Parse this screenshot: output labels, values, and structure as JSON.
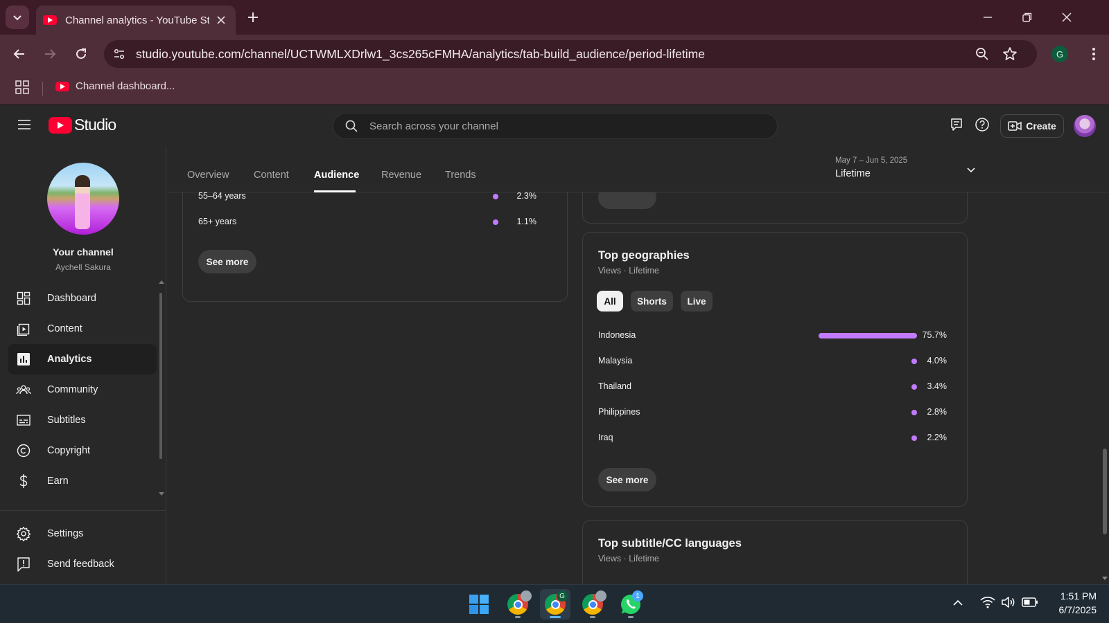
{
  "browser": {
    "tab_title": "Channel analytics - YouTube Studio",
    "url": "studio.youtube.com/channel/UCTWMLXDrlw1_3cs265cFMHA/analytics/tab-build_audience/period-lifetime",
    "bookmark_label": "Channel dashboard...",
    "profile_initial": "G"
  },
  "header": {
    "logo_text": "Studio",
    "search_placeholder": "Search across your channel",
    "create_label": "Create"
  },
  "sidebar": {
    "your_channel": "Your channel",
    "channel_name": "Aychell Sakura",
    "items": [
      {
        "label": "Dashboard",
        "icon": "dashboard-icon"
      },
      {
        "label": "Content",
        "icon": "content-icon"
      },
      {
        "label": "Analytics",
        "icon": "analytics-icon",
        "active": true
      },
      {
        "label": "Community",
        "icon": "community-icon"
      },
      {
        "label": "Subtitles",
        "icon": "subtitles-icon"
      },
      {
        "label": "Copyright",
        "icon": "copyright-icon"
      },
      {
        "label": "Earn",
        "icon": "earn-icon"
      }
    ],
    "bottom_items": [
      {
        "label": "Settings",
        "icon": "gear-icon"
      },
      {
        "label": "Send feedback",
        "icon": "feedback-icon"
      }
    ]
  },
  "tabs": {
    "overview": "Overview",
    "content": "Content",
    "audience": "Audience",
    "revenue": "Revenue",
    "trends": "Trends",
    "active": "Audience"
  },
  "period": {
    "range": "May 7 – Jun 5, 2025",
    "value": "Lifetime"
  },
  "age_card": {
    "rows": [
      {
        "label": "55–64 years",
        "value": "2.3%"
      },
      {
        "label": "65+ years",
        "value": "1.1%"
      }
    ],
    "see_more": "See more"
  },
  "geo_card": {
    "title": "Top geographies",
    "subtitle": "Views · Lifetime",
    "chips": [
      "All",
      "Shorts",
      "Live"
    ],
    "selected_chip": "All",
    "rows": [
      {
        "label": "Indonesia",
        "value": "75.7%",
        "fraction": 0.757
      },
      {
        "label": "Malaysia",
        "value": "4.0%",
        "fraction": 0.04
      },
      {
        "label": "Thailand",
        "value": "3.4%",
        "fraction": 0.034
      },
      {
        "label": "Philippines",
        "value": "2.8%",
        "fraction": 0.028
      },
      {
        "label": "Iraq",
        "value": "2.2%",
        "fraction": 0.022
      }
    ],
    "see_more": "See more"
  },
  "subtitle_card": {
    "title": "Top subtitle/CC languages",
    "subtitle": "Views · Lifetime"
  },
  "taskbar": {
    "whatsapp_badge": "1",
    "chrome_profile_badge": "G",
    "time": "1:51 PM",
    "date": "6/7/2025"
  },
  "colors": {
    "accent_purple": "#c27bff",
    "youtube_red": "#ff0033",
    "browser_frame": "#4f2d39"
  }
}
